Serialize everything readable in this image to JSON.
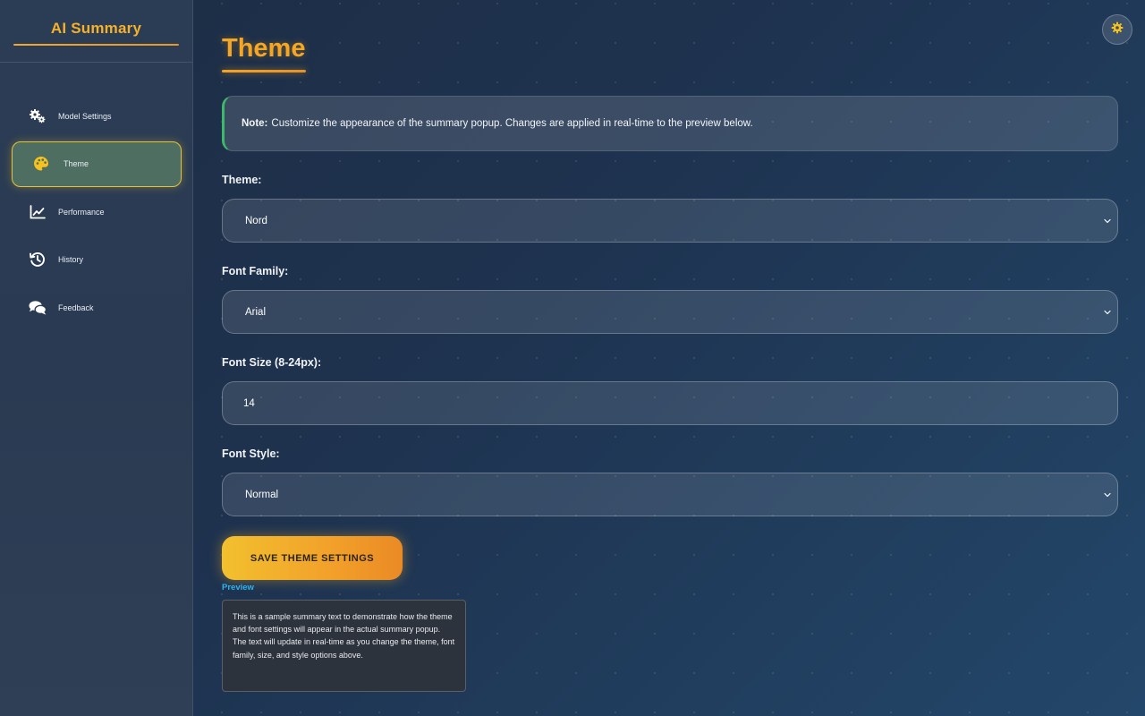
{
  "brand": {
    "title": "AI Summary"
  },
  "sidebar": {
    "items": [
      {
        "label": "Model Settings",
        "icon": "gears-icon",
        "active": false
      },
      {
        "label": "Theme",
        "icon": "palette-icon",
        "active": true
      },
      {
        "label": "Performance",
        "icon": "chart-line-icon",
        "active": false
      },
      {
        "label": "History",
        "icon": "history-icon",
        "active": false
      },
      {
        "label": "Feedback",
        "icon": "comments-icon",
        "active": false
      }
    ]
  },
  "page": {
    "title": "Theme"
  },
  "note": {
    "bold": "Note:",
    "text": "Customize the appearance of the summary popup. Changes are applied in real-time to the preview below."
  },
  "form": {
    "theme": {
      "label": "Theme:",
      "value": "Nord"
    },
    "font_family": {
      "label": "Font Family:",
      "value": "Arial"
    },
    "font_size": {
      "label": "Font Size (8-24px):",
      "value": "14"
    },
    "font_style": {
      "label": "Font Style:",
      "value": "Normal"
    },
    "save_label": "SAVE THEME SETTINGS"
  },
  "preview": {
    "label": "Preview",
    "text": "This is a sample summary text to demonstrate how the theme and font settings will appear in the actual summary popup. The text will update in real-time as you change the theme, font family, size, and style options above."
  },
  "colors": {
    "accent": "#f5a623",
    "active_border": "#e5c238",
    "note_border": "#3fb86a",
    "preview_label": "#2bb3ef"
  }
}
